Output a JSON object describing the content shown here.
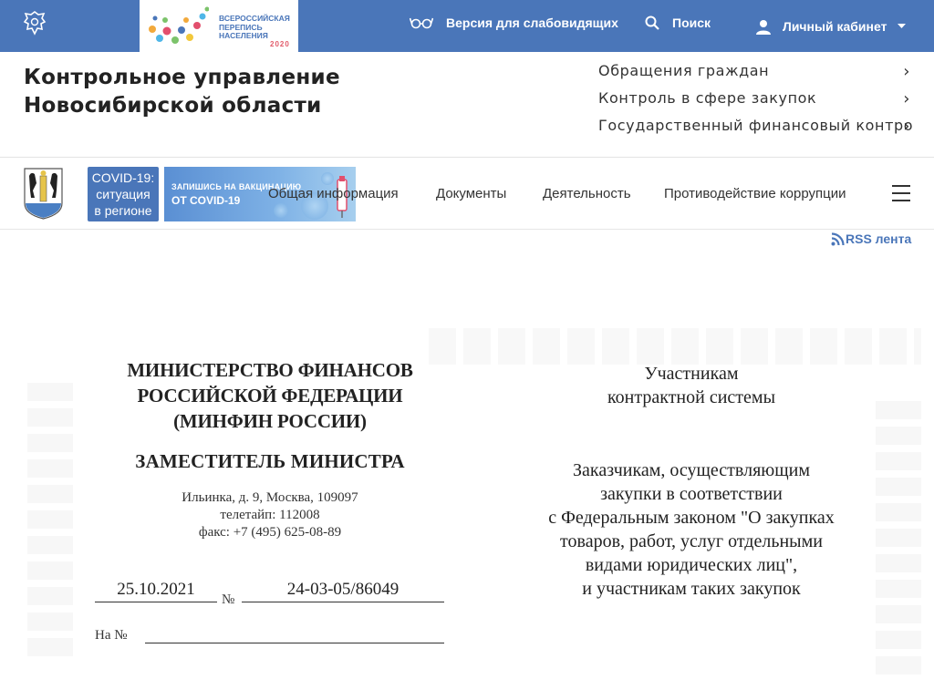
{
  "topbar": {
    "census_text": "ВСЕРОССИЙСКАЯ ПЕРЕПИСЬ НАСЕЛЕНИЯ",
    "census_year": "2020",
    "low_vision": "Версия для слабовидящих",
    "search": "Поиск",
    "cabinet": "Личный кабинет",
    "colors": {
      "bar": "#4a76b9"
    }
  },
  "header": {
    "title_line1": "Контрольное управление",
    "title_line2": "Новосибирской области",
    "links": [
      "Обращения граждан",
      "Контроль в сфере закупок",
      "Государственный финансовый контроль"
    ]
  },
  "navbar": {
    "covid_line1": "COVID-19:",
    "covid_line2": "ситуация",
    "covid_line3": "в регионе",
    "vaccine_line1": "ЗАПИШИСЬ НА ВАКЦИНАЦИЮ",
    "vaccine_line2": "ОТ COVID-19",
    "items": [
      "Общая информация",
      "Документы",
      "Деятельность",
      "Противодействие коррупции"
    ]
  },
  "rss": {
    "label": "RSS лента"
  },
  "document": {
    "ministry_line1": "МИНИСТЕРСТВО ФИНАНСОВ",
    "ministry_line2": "РОССИЙСКОЙ ФЕДЕРАЦИИ",
    "ministry_line3": "(МИНФИН РОССИИ)",
    "deputy": "ЗАМЕСТИТЕЛЬ МИНИСТРА",
    "address": "Ильинка, д. 9, Москва, 109097",
    "teletype": "телетайп: 112008",
    "fax": "факс: +7 (495) 625-08-89",
    "date": "25.10.2021",
    "no_sign": "№",
    "number": "24-03-05/86049",
    "ref_label": "На №",
    "addressee1_line1": "Участникам",
    "addressee1_line2": "контрактной системы",
    "addressee2": [
      "Заказчикам, осуществляющим",
      "закупки в соответствии",
      "с Федеральным законом \"О закупках",
      "товаров, работ, услуг отдельными",
      "видами юридических лиц\",",
      "и участникам таких закупок"
    ]
  }
}
